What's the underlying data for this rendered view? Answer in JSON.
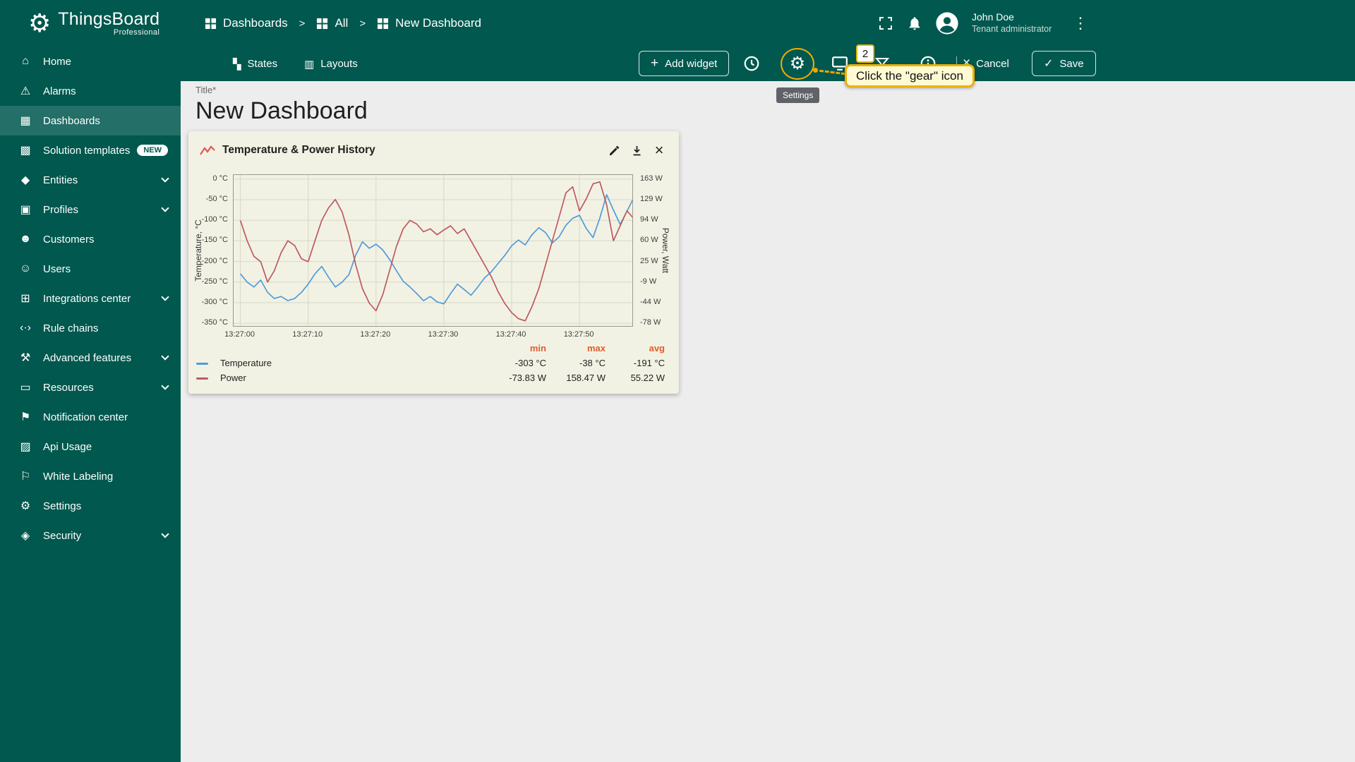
{
  "app": {
    "name": "ThingsBoard",
    "edition": "Professional"
  },
  "breadcrumb": {
    "separator": ">",
    "items": [
      {
        "label": "Dashboards"
      },
      {
        "label": "All"
      },
      {
        "label": "New Dashboard"
      }
    ]
  },
  "user": {
    "name": "John Doe",
    "role": "Tenant administrator"
  },
  "sidebar": {
    "items": [
      {
        "id": "home",
        "label": "Home",
        "icon": "home-icon"
      },
      {
        "id": "alarms",
        "label": "Alarms",
        "icon": "alarms-icon"
      },
      {
        "id": "dashboards",
        "label": "Dashboards",
        "icon": "dashboards-icon",
        "active": true
      },
      {
        "id": "solution-templates",
        "label": "Solution templates",
        "icon": "solution-templates-icon",
        "badge": "NEW"
      },
      {
        "id": "entities",
        "label": "Entities",
        "icon": "entities-icon",
        "expandable": true
      },
      {
        "id": "profiles",
        "label": "Profiles",
        "icon": "profiles-icon",
        "expandable": true
      },
      {
        "id": "customers",
        "label": "Customers",
        "icon": "customers-icon"
      },
      {
        "id": "users",
        "label": "Users",
        "icon": "users-icon"
      },
      {
        "id": "integrations-center",
        "label": "Integrations center",
        "icon": "integrations-icon",
        "expandable": true
      },
      {
        "id": "rule-chains",
        "label": "Rule chains",
        "icon": "rule-chains-icon"
      },
      {
        "id": "advanced-features",
        "label": "Advanced features",
        "icon": "advanced-features-icon",
        "expandable": true
      },
      {
        "id": "resources",
        "label": "Resources",
        "icon": "resources-icon",
        "expandable": true
      },
      {
        "id": "notification-center",
        "label": "Notification center",
        "icon": "notification-icon"
      },
      {
        "id": "api-usage",
        "label": "Api Usage",
        "icon": "api-usage-icon"
      },
      {
        "id": "white-labeling",
        "label": "White Labeling",
        "icon": "white-labeling-icon"
      },
      {
        "id": "settings",
        "label": "Settings",
        "icon": "settings-icon"
      },
      {
        "id": "security",
        "label": "Security",
        "icon": "security-icon",
        "expandable": true
      }
    ]
  },
  "toolbar": {
    "tabs": [
      {
        "label": "States",
        "icon": "states-icon"
      },
      {
        "label": "Layouts",
        "icon": "layouts-icon"
      }
    ],
    "add_widget_label": "Add widget",
    "cancel_label": "Cancel",
    "save_label": "Save"
  },
  "page": {
    "title_label": "Title*",
    "title": "New Dashboard"
  },
  "annotation": {
    "step": "2",
    "callout": "Click the \"gear\" icon",
    "tooltip": "Settings"
  },
  "colors": {
    "primary": "#00584e",
    "annotation": "#f0b000",
    "legend_header": "#e05d2b",
    "chart_background": "#f2f2e4"
  },
  "chart_data": {
    "type": "line",
    "title": "Temperature & Power History",
    "plot": {
      "x_domain": [
        -1,
        58
      ],
      "grid": true,
      "background": "#f2f2e4"
    },
    "x_ticks": [
      {
        "t": 0,
        "label": "13:27:00"
      },
      {
        "t": 10,
        "label": "13:27:10"
      },
      {
        "t": 20,
        "label": "13:27:20"
      },
      {
        "t": 30,
        "label": "13:27:30"
      },
      {
        "t": 40,
        "label": "13:27:40"
      },
      {
        "t": 50,
        "label": "13:27:50"
      }
    ],
    "left_axis": {
      "label": "Temperature, °C",
      "domain": [
        10,
        -360
      ],
      "tick_values": [
        0,
        -50,
        -100,
        -150,
        -200,
        -250,
        -300,
        -350
      ],
      "tick_labels": [
        "0 °C",
        "-50 °C",
        "-100 °C",
        "-150 °C",
        "-200 °C",
        "-250 °C",
        "-300 °C",
        "-350 °C"
      ]
    },
    "right_axis": {
      "label": "Power, Watt",
      "domain": [
        169.85,
        -84.65
      ],
      "tick_values": [
        163,
        129,
        94,
        60,
        25,
        -9,
        -44,
        -78
      ],
      "tick_labels": [
        "163 W",
        "129 W",
        "94 W",
        "60 W",
        "25 W",
        "-9 W",
        "-44 W",
        "-78 W"
      ]
    },
    "legend": {
      "columns": [
        "min",
        "max",
        "avg"
      ],
      "position": "bottom"
    },
    "series": [
      {
        "name": "Temperature",
        "axis": "left",
        "unit": "°C",
        "color": "#539bd8",
        "stats": {
          "min": "-303 °C",
          "max": "-38 °C",
          "avg": "-191 °C"
        },
        "x_seconds_start": 0,
        "x_seconds_step": 1,
        "y_values": [
          -230,
          -250,
          -262,
          -245,
          -275,
          -290,
          -285,
          -295,
          -290,
          -275,
          -255,
          -230,
          -212,
          -238,
          -262,
          -250,
          -232,
          -185,
          -152,
          -168,
          -158,
          -172,
          -195,
          -222,
          -248,
          -262,
          -278,
          -295,
          -285,
          -298,
          -303,
          -278,
          -255,
          -268,
          -282,
          -262,
          -240,
          -225,
          -205,
          -185,
          -162,
          -148,
          -160,
          -135,
          -118,
          -130,
          -155,
          -140,
          -112,
          -95,
          -88,
          -120,
          -142,
          -95,
          -38,
          -75,
          -110,
          -78,
          -45
        ]
      },
      {
        "name": "Power",
        "axis": "right",
        "unit": "W",
        "color": "#bd5a5f",
        "stats": {
          "min": "-73.83 W",
          "max": "158.47 W",
          "avg": "55.22 W"
        },
        "x_seconds_start": 0,
        "x_seconds_step": 1,
        "y_values": [
          94,
          60,
          34,
          25,
          -9,
          10,
          40,
          60,
          52,
          30,
          25,
          60,
          94,
          115,
          129,
          108,
          70,
          20,
          -20,
          -44,
          -57,
          -30,
          10,
          50,
          80,
          94,
          88,
          75,
          80,
          70,
          78,
          85,
          72,
          80,
          60,
          40,
          20,
          0,
          -25,
          -45,
          -60,
          -70,
          -73.83,
          -50,
          -20,
          20,
          60,
          100,
          140,
          150,
          110,
          130,
          155,
          158.47,
          120,
          60,
          85,
          110,
          97
        ]
      }
    ]
  }
}
